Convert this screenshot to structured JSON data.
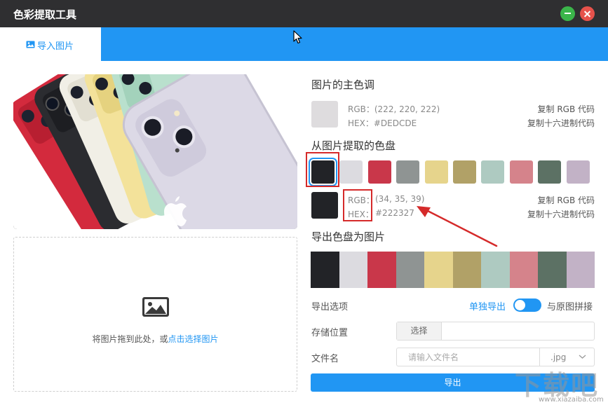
{
  "window": {
    "title": "色彩提取工具",
    "minimize_icon": "minus-icon",
    "close_icon": "x-icon"
  },
  "tabs": [
    {
      "label": "导入图片",
      "icon": "image-icon",
      "active": true
    }
  ],
  "upload": {
    "text_before": "将图片拖到此处，或",
    "link_text": "点击选择图片",
    "icon": "image-icon"
  },
  "dominant": {
    "title": "图片的主色调",
    "color": "#DEDCDE",
    "rgb_text": "RGB：(222, 220, 222)",
    "hex_text": "HEX：#DEDCDE",
    "copy_rgb": "复制 RGB 代码",
    "copy_hex": "复制十六进制代码"
  },
  "palette": {
    "title": "从图片提取的色盘",
    "colors": [
      "#222327",
      "#dcdbe0",
      "#c9374a",
      "#8f9493",
      "#e6d48c",
      "#b1a167",
      "#aecac1",
      "#d5838b",
      "#5c7164",
      "#c2b2c6"
    ],
    "selected_index": 0
  },
  "selected": {
    "color": "#222327",
    "rgb_label": "RGB：",
    "rgb_value": "(34, 35, 39)",
    "hex_label": "HEX：",
    "hex_value": "#222327",
    "copy_rgb": "复制 RGB 代码",
    "copy_hex": "复制十六进制代码"
  },
  "export": {
    "title": "导出色盘为图片",
    "options_label": "导出选项",
    "mode_separate": "单独导出",
    "mode_combine": "与原图拼接",
    "toggle_on": true,
    "location_label": "存储位置",
    "select_button": "选择",
    "filename_label": "文件名",
    "filename_placeholder": "请输入文件名",
    "ext": ".jpg",
    "button": "导出"
  },
  "watermark": {
    "mark": "下载吧",
    "url": "www.xiazaiba.com"
  },
  "colors": {
    "accent": "#2196f3",
    "titlebar": "#2f2f31",
    "annotation": "#d52a2a"
  }
}
